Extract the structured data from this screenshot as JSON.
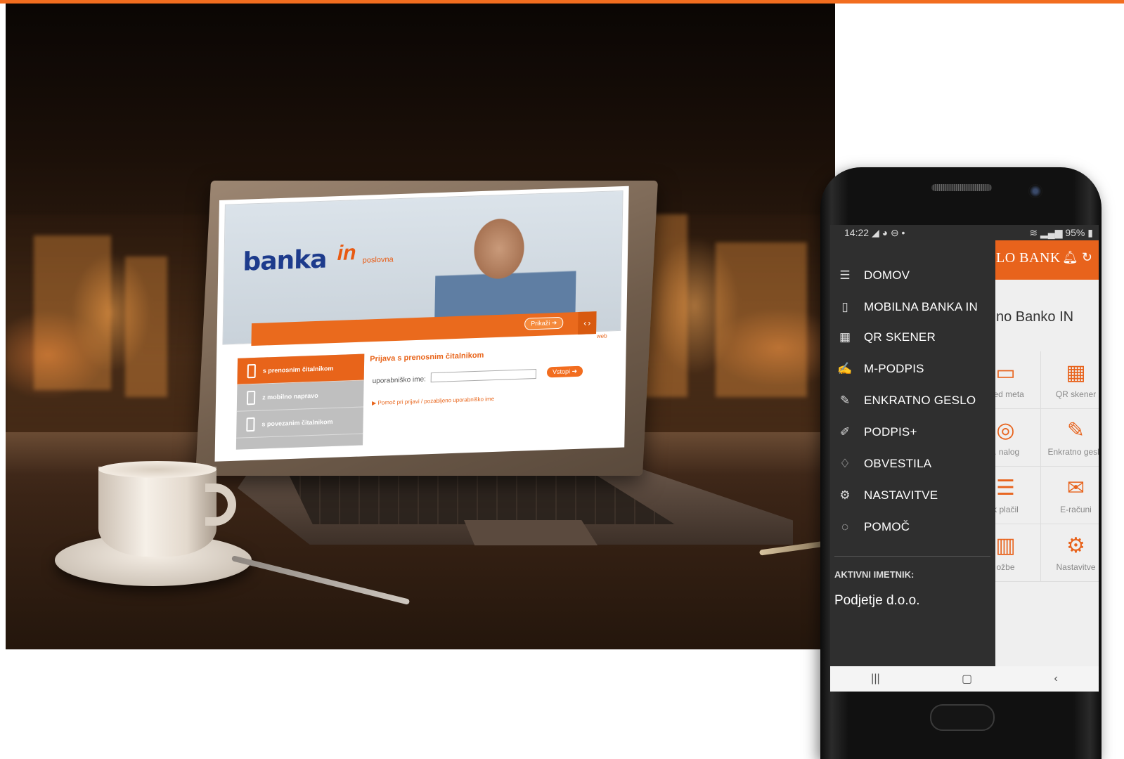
{
  "brand": {
    "accent": "#e8631c",
    "top_bar": "#f26d1f"
  },
  "laptop": {
    "logo": "banka",
    "logo_mark": "in",
    "logo_sub": "poslovna",
    "banner_button": "Prikaži",
    "web_tag": "web",
    "login_options": [
      {
        "label": "s prenosnim čitalnikom",
        "icon": "card-reader-icon"
      },
      {
        "label": "z mobilno napravo",
        "icon": "mobile-device-icon"
      },
      {
        "label": "s povezanim čitalnikom",
        "icon": "connected-reader-icon"
      }
    ],
    "form_title": "Prijava s prenosnim čitalnikom",
    "username_label": "uporabniško ime:",
    "username_value": "",
    "login_button": "Vstopi",
    "help_link": "Pomoč pri prijavi / pozabljeno uporabniško ime"
  },
  "phone": {
    "status": {
      "time": "14:22",
      "icons": "◢ ◕ ⊖ •",
      "battery": "95%"
    },
    "header_title": "LO BANK",
    "welcome_text": "no Banko IN",
    "tiles": [
      {
        "label": "gled meta",
        "icon": "wallet-icon"
      },
      {
        "label": "QR skener",
        "icon": "qr-icon"
      },
      {
        "label": "t. nalog",
        "icon": "payment-order-icon"
      },
      {
        "label": "Enkratno geslo",
        "icon": "pen-icon"
      },
      {
        "label": "k plačil",
        "icon": "list-icon"
      },
      {
        "label": "E-računi",
        "icon": "envelope-icon"
      },
      {
        "label": "ožbe",
        "icon": "chart-icon"
      },
      {
        "label": "Nastavitve",
        "icon": "gear-icon"
      }
    ],
    "menu": [
      {
        "label": "DOMOV",
        "icon": "hamburger-icon"
      },
      {
        "label": "MOBILNA BANKA IN",
        "icon": "phone-icon"
      },
      {
        "label": "QR SKENER",
        "icon": "qr-icon"
      },
      {
        "label": "M-PODPIS",
        "icon": "signature-icon"
      },
      {
        "label": "ENKRATNO GESLO",
        "icon": "pen-icon"
      },
      {
        "label": "PODPIS+",
        "icon": "signature-plus-icon"
      },
      {
        "label": "OBVESTILA",
        "icon": "bell-icon"
      },
      {
        "label": "NASTAVITVE",
        "icon": "gear-icon"
      },
      {
        "label": "POMOČ",
        "icon": "help-chat-icon"
      }
    ],
    "holder_label": "AKTIVNI IMETNIK:",
    "holder_name": "Podjetje d.o.o."
  }
}
